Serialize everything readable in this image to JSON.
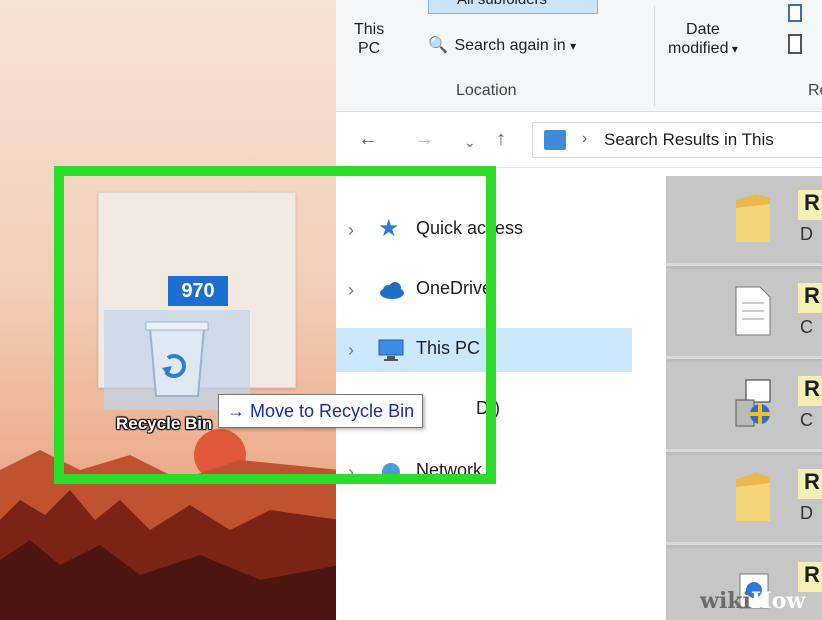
{
  "ribbon": {
    "this_pc_line1": "This",
    "this_pc_line2": "PC",
    "all_subfolders": "All subfolders",
    "search_again_in": "Search again in",
    "date_line1": "Date",
    "date_line2": "modified",
    "location_label": "Location",
    "refine_label_partial": "Re"
  },
  "address_bar": {
    "path": "Search Results in This"
  },
  "nav_pane": {
    "items": [
      {
        "label": "Quick access",
        "icon": "star-icon"
      },
      {
        "label": "OneDrive",
        "icon": "cloud-icon"
      },
      {
        "label": "This PC",
        "icon": "monitor-icon"
      },
      {
        "label": "D:)",
        "icon": "drive-icon"
      },
      {
        "label": "Network",
        "icon": "network-icon"
      }
    ]
  },
  "results": {
    "rows": [
      {
        "name": "R",
        "sub": "D",
        "icon": "folder-icon"
      },
      {
        "name": "R",
        "sub": "C",
        "icon": "document-icon"
      },
      {
        "name": "R",
        "sub": "C",
        "icon": "installer-icon"
      },
      {
        "name": "R",
        "sub": "D",
        "icon": "folder-icon"
      },
      {
        "name": "R",
        "sub": "",
        "icon": "web-icon"
      }
    ]
  },
  "drag": {
    "count": "970",
    "recycle_bin_label": "Recycle Bin",
    "tooltip_arrow": "→",
    "tooltip_text": "Move to Recycle Bin"
  },
  "watermark": {
    "wiki": "wiki",
    "how": "How"
  },
  "colors": {
    "highlight": "#2bdc2b",
    "badge": "#1a6fd1",
    "selected_nav": "#cce8ff"
  }
}
